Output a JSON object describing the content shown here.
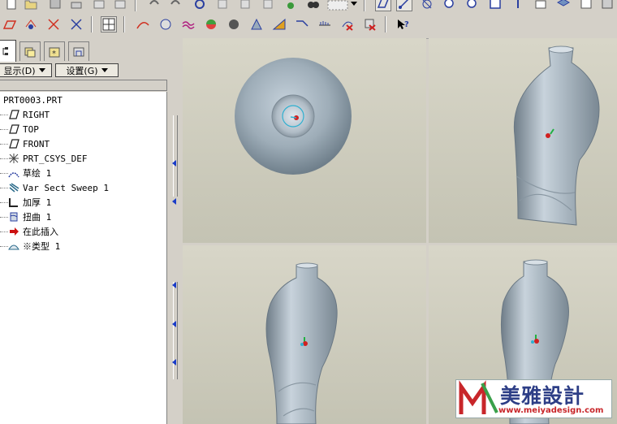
{
  "model_tree": {
    "show_label": "显示(D)",
    "settings_label": "设置(G)",
    "items": [
      {
        "label": "PRT0003.PRT",
        "icon": "part-icon"
      },
      {
        "label": "RIGHT",
        "icon": "datum-plane-icon"
      },
      {
        "label": "TOP",
        "icon": "datum-plane-icon"
      },
      {
        "label": "FRONT",
        "icon": "datum-plane-icon"
      },
      {
        "label": "PRT_CSYS_DEF",
        "icon": "csys-icon"
      },
      {
        "label": "草绘 1",
        "icon": "sketch-icon"
      },
      {
        "label": "Var Sect Sweep 1",
        "icon": "var-sect-sweep-icon"
      },
      {
        "label": "加厚 1",
        "icon": "thicken-icon"
      },
      {
        "label": "扭曲 1",
        "icon": "warp-icon"
      },
      {
        "label": "在此插入",
        "icon": "insert-here-arrow-icon"
      },
      {
        "label": "※类型 1",
        "icon": "style-icon"
      }
    ]
  },
  "watermark": {
    "title": "美雅設計",
    "url": "www.meiyadesign.com"
  },
  "colors": {
    "part": "#9aa8b4",
    "insert_arrow": "#cc1010"
  }
}
